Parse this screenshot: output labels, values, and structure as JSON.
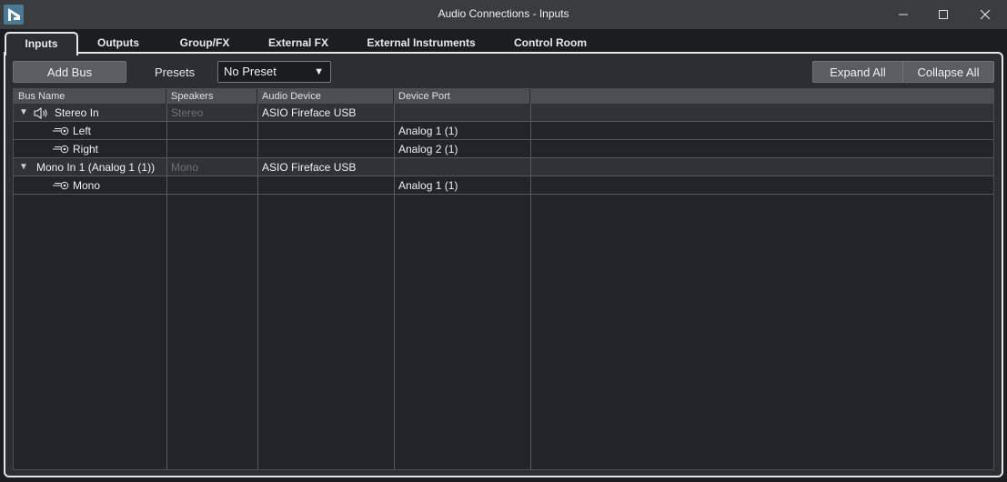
{
  "window": {
    "title": "Audio Connections - Inputs"
  },
  "tabs": [
    {
      "label": "Inputs",
      "active": true
    },
    {
      "label": "Outputs",
      "active": false
    },
    {
      "label": "Group/FX",
      "active": false
    },
    {
      "label": "External FX",
      "active": false
    },
    {
      "label": "External Instruments",
      "active": false
    },
    {
      "label": "Control Room",
      "active": false
    }
  ],
  "toolbar": {
    "add_bus_label": "Add Bus",
    "presets_label": "Presets",
    "preset_value": "No Preset",
    "expand_all_label": "Expand All",
    "collapse_all_label": "Collapse All"
  },
  "table": {
    "headers": [
      "Bus Name",
      "Speakers",
      "Audio Device",
      "Device Port"
    ],
    "rows": [
      {
        "kind": "bus",
        "name": "Stereo In",
        "speakers": "Stereo",
        "device": "ASIO Fireface USB",
        "port": "",
        "icon": "speaker-icon"
      },
      {
        "kind": "channel",
        "name": "Left",
        "speakers": "",
        "device": "",
        "port": "Analog 1 (1)",
        "icon": "input-port-icon"
      },
      {
        "kind": "channel",
        "name": "Right",
        "speakers": "",
        "device": "",
        "port": "Analog 2 (1)",
        "icon": "input-port-icon"
      },
      {
        "kind": "bus",
        "name": "Mono In 1 (Analog 1 (1))",
        "speakers": "Mono",
        "device": "ASIO Fireface USB",
        "port": "",
        "icon": ""
      },
      {
        "kind": "channel",
        "name": "Mono",
        "speakers": "",
        "device": "",
        "port": "Analog 1 (1)",
        "icon": "input-port-icon"
      }
    ]
  },
  "colors": {
    "background": "#1b1d20",
    "panel": "#2b2e32",
    "titlebar": "#3a3c3f",
    "header": "#4b4e52",
    "dim_text": "#6e7175"
  }
}
